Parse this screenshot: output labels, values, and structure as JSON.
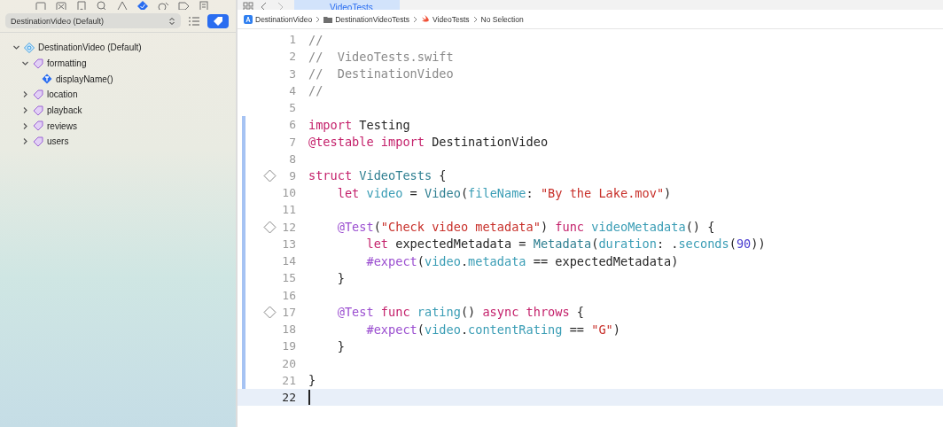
{
  "navigator": {
    "tabs": [
      {
        "kind": "folder",
        "selected": false
      },
      {
        "kind": "xbox",
        "selected": false
      },
      {
        "kind": "bookmark",
        "selected": false
      },
      {
        "kind": "search",
        "selected": false
      },
      {
        "kind": "warning",
        "selected": false
      },
      {
        "kind": "test",
        "selected": true
      },
      {
        "kind": "debug",
        "selected": false
      },
      {
        "kind": "tag",
        "selected": false
      },
      {
        "kind": "report",
        "selected": false
      }
    ],
    "scheme": "DestinationVideo (Default)",
    "filter_on": true,
    "tree": [
      {
        "kind": "project",
        "label": "DestinationVideo (Default)",
        "expanded": true,
        "children": [
          {
            "kind": "tag",
            "label": "formatting",
            "expanded": true,
            "children": [
              {
                "kind": "test",
                "label": "displayName()"
              }
            ]
          },
          {
            "kind": "tag",
            "label": "location",
            "expanded": false
          },
          {
            "kind": "tag",
            "label": "playback",
            "expanded": false
          },
          {
            "kind": "tag",
            "label": "reviews",
            "expanded": false
          },
          {
            "kind": "tag",
            "label": "users",
            "expanded": false
          }
        ]
      }
    ]
  },
  "editor": {
    "tab": "VideoTests",
    "breadcrumb": [
      {
        "kind": "app",
        "label": "DestinationVideo"
      },
      {
        "kind": "folder",
        "label": "DestinationVideoTests"
      },
      {
        "kind": "swift",
        "label": "VideoTests"
      },
      {
        "kind": "none",
        "label": "No Selection"
      }
    ],
    "lines": [
      {
        "number": "1",
        "changed": false,
        "diamond": false,
        "current": false,
        "tokens": [
          {
            "kind": "comment",
            "text": "//"
          }
        ]
      },
      {
        "number": "2",
        "changed": false,
        "diamond": false,
        "current": false,
        "tokens": [
          {
            "kind": "comment",
            "text": "//  VideoTests.swift"
          }
        ]
      },
      {
        "number": "3",
        "changed": false,
        "diamond": false,
        "current": false,
        "tokens": [
          {
            "kind": "comment",
            "text": "//  DestinationVideo"
          }
        ]
      },
      {
        "number": "4",
        "changed": false,
        "diamond": false,
        "current": false,
        "tokens": [
          {
            "kind": "comment",
            "text": "//"
          }
        ]
      },
      {
        "number": "5",
        "changed": false,
        "diamond": false,
        "current": false
      },
      {
        "number": "6",
        "changed": true,
        "diamond": false,
        "current": false,
        "tokens": [
          {
            "kind": "keyword",
            "text": "import "
          },
          {
            "kind": "plain",
            "text": "Testing"
          }
        ]
      },
      {
        "number": "7",
        "changed": true,
        "diamond": false,
        "current": false,
        "tokens": [
          {
            "kind": "keyword",
            "text": "@testable import "
          },
          {
            "kind": "plain",
            "text": "DestinationVideo"
          }
        ]
      },
      {
        "number": "8",
        "changed": true,
        "diamond": false,
        "current": false
      },
      {
        "number": "9",
        "changed": true,
        "diamond": true,
        "current": false,
        "tokens": [
          {
            "kind": "keyword",
            "text": "struct "
          },
          {
            "kind": "type",
            "text": "VideoTests"
          },
          {
            "kind": "plain",
            "text": " {"
          }
        ]
      },
      {
        "number": "10",
        "changed": true,
        "diamond": false,
        "current": false,
        "tokens": [
          {
            "kind": "keyword",
            "text": "    let "
          },
          {
            "kind": "prop",
            "text": "video"
          },
          {
            "kind": "plain",
            "text": " = "
          },
          {
            "kind": "type",
            "text": "Video"
          },
          {
            "kind": "plain",
            "text": "("
          },
          {
            "kind": "prop",
            "text": "fileName"
          },
          {
            "kind": "plain",
            "text": ": "
          },
          {
            "kind": "string",
            "text": "\"By the Lake.mov\""
          },
          {
            "kind": "plain",
            "text": ")"
          }
        ]
      },
      {
        "number": "11",
        "changed": true,
        "diamond": false,
        "current": false
      },
      {
        "number": "12",
        "changed": true,
        "diamond": true,
        "current": false,
        "tokens": [
          {
            "kind": "macro",
            "text": "    @Test"
          },
          {
            "kind": "plain",
            "text": "("
          },
          {
            "kind": "string",
            "text": "\"Check video metadata\""
          },
          {
            "kind": "plain",
            "text": ") "
          },
          {
            "kind": "keyword",
            "text": "func "
          },
          {
            "kind": "prop",
            "text": "videoMetadata"
          },
          {
            "kind": "plain",
            "text": "() {"
          }
        ]
      },
      {
        "number": "13",
        "changed": true,
        "diamond": false,
        "current": false,
        "tokens": [
          {
            "kind": "keyword",
            "text": "        let "
          },
          {
            "kind": "plain",
            "text": "expectedMetadata = "
          },
          {
            "kind": "type",
            "text": "Metadata"
          },
          {
            "kind": "plain",
            "text": "("
          },
          {
            "kind": "prop",
            "text": "duration"
          },
          {
            "kind": "plain",
            "text": ": ."
          },
          {
            "kind": "prop",
            "text": "seconds"
          },
          {
            "kind": "plain",
            "text": "("
          },
          {
            "kind": "number",
            "text": "90"
          },
          {
            "kind": "plain",
            "text": "))"
          }
        ]
      },
      {
        "number": "14",
        "changed": true,
        "diamond": false,
        "current": false,
        "tokens": [
          {
            "kind": "macro",
            "text": "        #expect"
          },
          {
            "kind": "plain",
            "text": "("
          },
          {
            "kind": "prop",
            "text": "video"
          },
          {
            "kind": "plain",
            "text": "."
          },
          {
            "kind": "prop",
            "text": "metadata"
          },
          {
            "kind": "plain",
            "text": " == expectedMetadata)"
          }
        ]
      },
      {
        "number": "15",
        "changed": true,
        "diamond": false,
        "current": false,
        "tokens": [
          {
            "kind": "plain",
            "text": "    }"
          }
        ]
      },
      {
        "number": "16",
        "changed": true,
        "diamond": false,
        "current": false
      },
      {
        "number": "17",
        "changed": true,
        "diamond": true,
        "current": false,
        "tokens": [
          {
            "kind": "macro",
            "text": "    @Test "
          },
          {
            "kind": "keyword",
            "text": "func "
          },
          {
            "kind": "prop",
            "text": "rating"
          },
          {
            "kind": "plain",
            "text": "() "
          },
          {
            "kind": "keyword",
            "text": "async throws"
          },
          {
            "kind": "plain",
            "text": " {"
          }
        ]
      },
      {
        "number": "18",
        "changed": true,
        "diamond": false,
        "current": false,
        "tokens": [
          {
            "kind": "macro",
            "text": "        #expect"
          },
          {
            "kind": "plain",
            "text": "("
          },
          {
            "kind": "prop",
            "text": "video"
          },
          {
            "kind": "plain",
            "text": "."
          },
          {
            "kind": "prop",
            "text": "contentRating"
          },
          {
            "kind": "plain",
            "text": " == "
          },
          {
            "kind": "string",
            "text": "\"G\""
          },
          {
            "kind": "plain",
            "text": ")"
          }
        ]
      },
      {
        "number": "19",
        "changed": true,
        "diamond": false,
        "current": false,
        "tokens": [
          {
            "kind": "plain",
            "text": "    }"
          }
        ]
      },
      {
        "number": "20",
        "changed": true,
        "diamond": false,
        "current": false
      },
      {
        "number": "21",
        "changed": true,
        "diamond": false,
        "current": false,
        "tokens": [
          {
            "kind": "plain",
            "text": "}"
          }
        ]
      },
      {
        "number": "22",
        "changed": false,
        "diamond": false,
        "current": true
      }
    ]
  }
}
